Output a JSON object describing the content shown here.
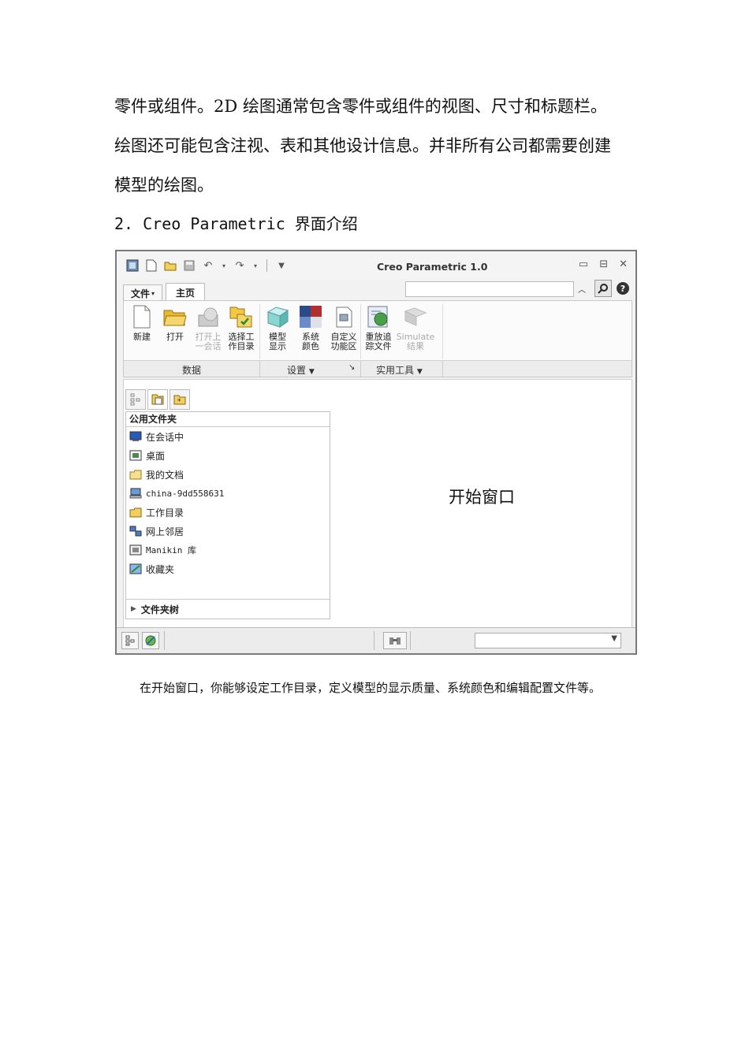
{
  "paragraph": [
    "零件或组件。2D 绘图通常包含零件或组件的视图、尺寸和标题栏。",
    "绘图还可能包含注视、表和其他设计信息。并非所有公司都需要创建",
    "模型的绘图。"
  ],
  "section_heading": "2. Creo Parametric 界面介绍",
  "window": {
    "title": "Creo Parametric 1.0",
    "tabs": {
      "file": "文件",
      "home": "主页"
    },
    "ribbon": {
      "buttons": [
        {
          "label": "新建",
          "icon": "new-file-icon"
        },
        {
          "label": "打开",
          "icon": "open-folder-icon"
        },
        {
          "label": "打开上\n一会话",
          "icon": "open-last-session-icon",
          "disabled": true
        },
        {
          "label": "选择工\n作目录",
          "icon": "select-working-directory-icon"
        },
        {
          "label": "模型\n显示",
          "icon": "model-display-icon"
        },
        {
          "label": "系统\n颜色",
          "icon": "system-colors-icon"
        },
        {
          "label": "自定义\n功能区",
          "icon": "customize-ribbon-icon"
        },
        {
          "label": "重放追\n踪文件",
          "icon": "play-trail-file-icon"
        },
        {
          "label": "Simulate\n结果",
          "icon": "simulate-results-icon",
          "disabled": true
        }
      ],
      "groups": {
        "data": "数据",
        "settings": "设置",
        "utilities": "实用工具"
      }
    },
    "navigator": {
      "header": "公用文件夹",
      "items": [
        {
          "label": "在会话中",
          "icon": "in-session-icon"
        },
        {
          "label": "桌面",
          "icon": "desktop-icon"
        },
        {
          "label": "我的文档",
          "icon": "my-documents-icon"
        },
        {
          "label": "china-9dd558631",
          "icon": "computer-icon"
        },
        {
          "label": "工作目录",
          "icon": "working-directory-icon"
        },
        {
          "label": "网上邻居",
          "icon": "network-icon"
        },
        {
          "label": "Manikin 库",
          "icon": "manikin-library-icon"
        },
        {
          "label": "收藏夹",
          "icon": "favorites-icon"
        }
      ],
      "footer": "文件夹树"
    },
    "start_window_label": "开始窗口"
  },
  "caption": "在开始窗口，你能够设定工作目录，定义模型的显示质量、系统颜色和编辑配置文件等。"
}
